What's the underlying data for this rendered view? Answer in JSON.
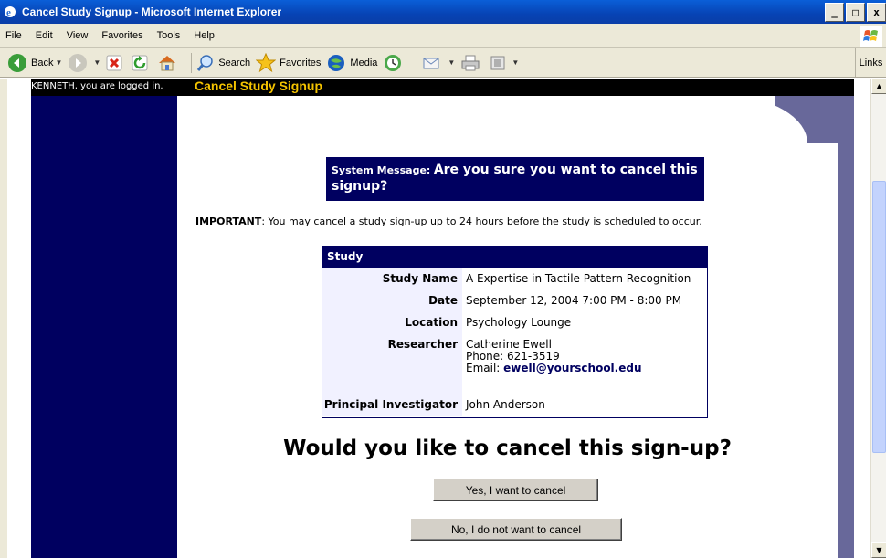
{
  "window": {
    "title": "Cancel Study Signup - Microsoft Internet Explorer",
    "minimize": "_",
    "maximize": "□",
    "close": "x"
  },
  "menu": [
    "File",
    "Edit",
    "View",
    "Favorites",
    "Tools",
    "Help"
  ],
  "toolbar": {
    "back": "Back",
    "search": "Search",
    "favorites": "Favorites",
    "media": "Media",
    "links": "Links"
  },
  "header": {
    "logged_in": "KENNETH, you are logged in.",
    "page_title": "Cancel Study Signup"
  },
  "system_message": {
    "label": "System Message:",
    "text": "Are you sure you want to cancel this signup?"
  },
  "important": {
    "label": "IMPORTANT",
    "text": ": You may cancel a study sign-up up to 24 hours before the study is scheduled to occur."
  },
  "study": {
    "heading": "Study",
    "name_label": "Study Name",
    "name": "A Expertise in Tactile Pattern Recognition",
    "date_label": "Date",
    "date": "September 12, 2004 7:00 PM - 8:00 PM",
    "location_label": "Location",
    "location": "Psychology Lounge",
    "researcher_label": "Researcher",
    "researcher_name": "Catherine Ewell",
    "researcher_phone": "Phone: 621-3519",
    "researcher_email_label": "Email: ",
    "researcher_email": "ewell@yourschool.edu",
    "pi_label": "Principal Investigator",
    "pi": "John Anderson"
  },
  "question": "Would you like to cancel this sign-up?",
  "buttons": {
    "yes": "Yes, I want to cancel",
    "no": "No, I do not want to cancel"
  },
  "colors": {
    "navy": "#000060",
    "title_yellow": "#f5c400",
    "right_column": "#68689a"
  }
}
